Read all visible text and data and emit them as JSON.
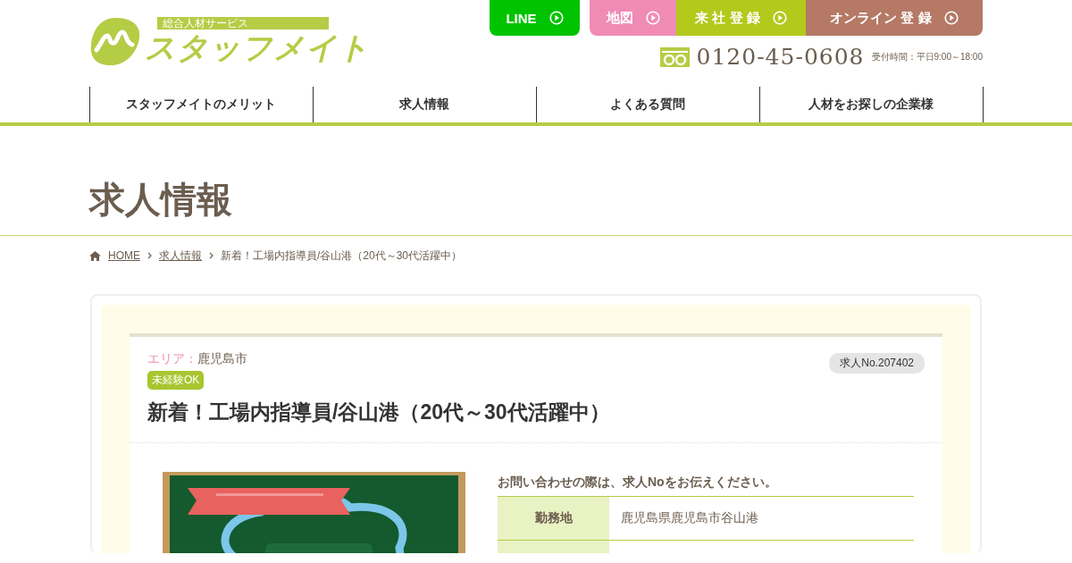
{
  "logo": {
    "tagline": "総合人材サービス",
    "name": "スタッフメイト"
  },
  "header_buttons": [
    {
      "label": "LINE",
      "color": "#00c300"
    },
    {
      "label": "地図",
      "color": "#f08bb5"
    },
    {
      "label": "来 社 登 録",
      "color": "#b3c91c"
    },
    {
      "label": "オンライン 登 録",
      "color": "#b57965"
    }
  ],
  "phone": {
    "number": "0120-45-0608",
    "hours": "受付時間：平日9:00～18:00"
  },
  "nav": [
    {
      "label": "スタッフメイトのメリット"
    },
    {
      "label": "求人情報"
    },
    {
      "label": "よくある質問"
    },
    {
      "label": "人材をお探しの企業様"
    }
  ],
  "page_title": "求人情報",
  "breadcrumb": [
    {
      "label": "HOME",
      "kind": "link"
    },
    {
      "label": "求人情報",
      "kind": "link"
    },
    {
      "label": "新着！工場内指導員/谷山港（20代～30代活躍中）",
      "kind": "current"
    }
  ],
  "job": {
    "area_label": "エリア：",
    "area": "鹿児島市",
    "job_no": "求人No.207402",
    "tags": [
      "未経験OK"
    ],
    "title": "新着！工場内指導員/谷山港（20代～30代活躍中）",
    "notice": "お問い合わせの際は、求人Noをお伝えください。",
    "details": [
      {
        "label": "勤務地",
        "value": "鹿児島県鹿児島市谷山港"
      }
    ]
  }
}
